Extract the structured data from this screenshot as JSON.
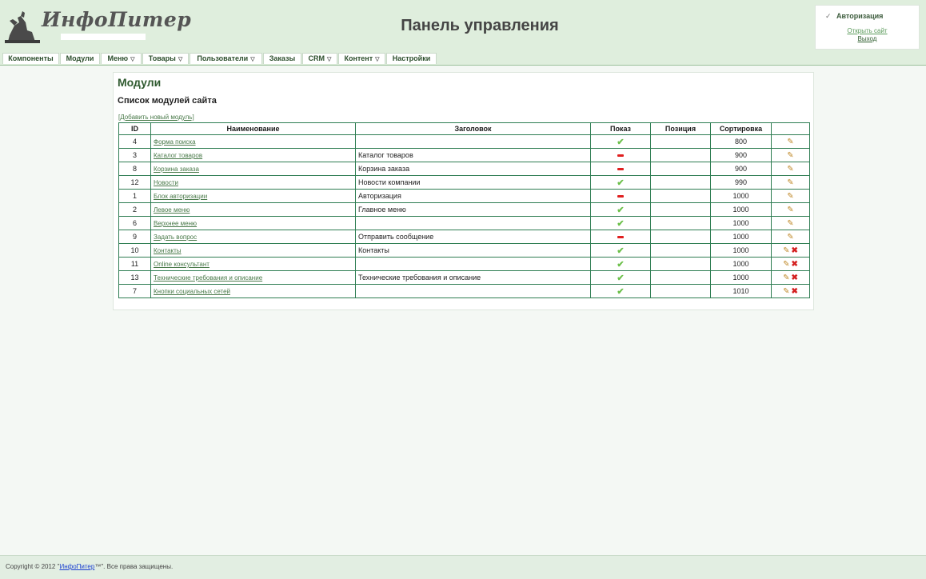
{
  "header": {
    "logo_text": "ИнфоПитер",
    "title": "Панель управления",
    "auth": {
      "title": "Авторизация",
      "open_site": "Открыть сайт",
      "logout": "Выход"
    }
  },
  "menu": {
    "items": [
      {
        "label": "Компоненты",
        "dropdown": false
      },
      {
        "label": "Модули",
        "dropdown": false
      },
      {
        "label": "Меню",
        "dropdown": true
      },
      {
        "label": "Товары",
        "dropdown": true
      },
      {
        "label": "Пользователи",
        "dropdown": true
      },
      {
        "label": "Заказы",
        "dropdown": false
      },
      {
        "label": "CRM",
        "dropdown": true
      },
      {
        "label": "Контент",
        "dropdown": true
      },
      {
        "label": "Настройки",
        "dropdown": false
      }
    ]
  },
  "content": {
    "heading": "Модули",
    "subheading": "Список модулей сайта",
    "add_link": "[Добавить новый модуль]",
    "columns": [
      "ID",
      "Наименование",
      "Заголовок",
      "Показ",
      "Позиция",
      "Сортировка",
      ""
    ],
    "rows": [
      {
        "id": "4",
        "name": "Форма поиска",
        "title": "",
        "show": true,
        "position": "",
        "sort": "800",
        "deletable": false
      },
      {
        "id": "3",
        "name": "Каталог товаров",
        "title": "Каталог товаров",
        "show": false,
        "position": "",
        "sort": "900",
        "deletable": false
      },
      {
        "id": "8",
        "name": "Корзина заказа",
        "title": "Корзина заказа",
        "show": false,
        "position": "",
        "sort": "900",
        "deletable": false
      },
      {
        "id": "12",
        "name": "Новости",
        "title": "Новости компании",
        "show": true,
        "position": "",
        "sort": "990",
        "deletable": false
      },
      {
        "id": "1",
        "name": "Блок авторизации",
        "title": "Авторизация",
        "show": false,
        "position": "",
        "sort": "1000",
        "deletable": false
      },
      {
        "id": "2",
        "name": "Левое меню",
        "title": "Главное меню",
        "show": true,
        "position": "",
        "sort": "1000",
        "deletable": false
      },
      {
        "id": "6",
        "name": "Верхнее меню",
        "title": "",
        "show": true,
        "position": "",
        "sort": "1000",
        "deletable": false
      },
      {
        "id": "9",
        "name": "Задать вопрос",
        "title": "Отправить сообщение",
        "show": false,
        "position": "",
        "sort": "1000",
        "deletable": false
      },
      {
        "id": "10",
        "name": "Контакты",
        "title": "Контакты",
        "show": true,
        "position": "",
        "sort": "1000",
        "deletable": true
      },
      {
        "id": "11",
        "name": "Online консультант",
        "title": "",
        "show": true,
        "position": "",
        "sort": "1000",
        "deletable": true
      },
      {
        "id": "13",
        "name": "Технические требования и описание",
        "title": "Технические требования и описание",
        "show": true,
        "position": "",
        "sort": "1000",
        "deletable": true
      },
      {
        "id": "7",
        "name": "Кнопки социальных сетей",
        "title": "",
        "show": true,
        "position": "",
        "sort": "1010",
        "deletable": true
      }
    ]
  },
  "footer": {
    "prefix": "Copyright © 2012 \"",
    "brand": "ИнфоПитер",
    "suffix": "™\". Все права защищены."
  },
  "icons": {
    "show_on": "check-icon",
    "show_off": "minus-icon",
    "edit": "pencil-icon",
    "delete": "delete-x-icon"
  },
  "colors": {
    "header_bg": "#dfeedd",
    "page_bg": "#f4f8f4",
    "table_border": "#2e7d52",
    "accent_green": "#2f5a2f",
    "check": "#6cc04a",
    "off": "#e02020"
  }
}
